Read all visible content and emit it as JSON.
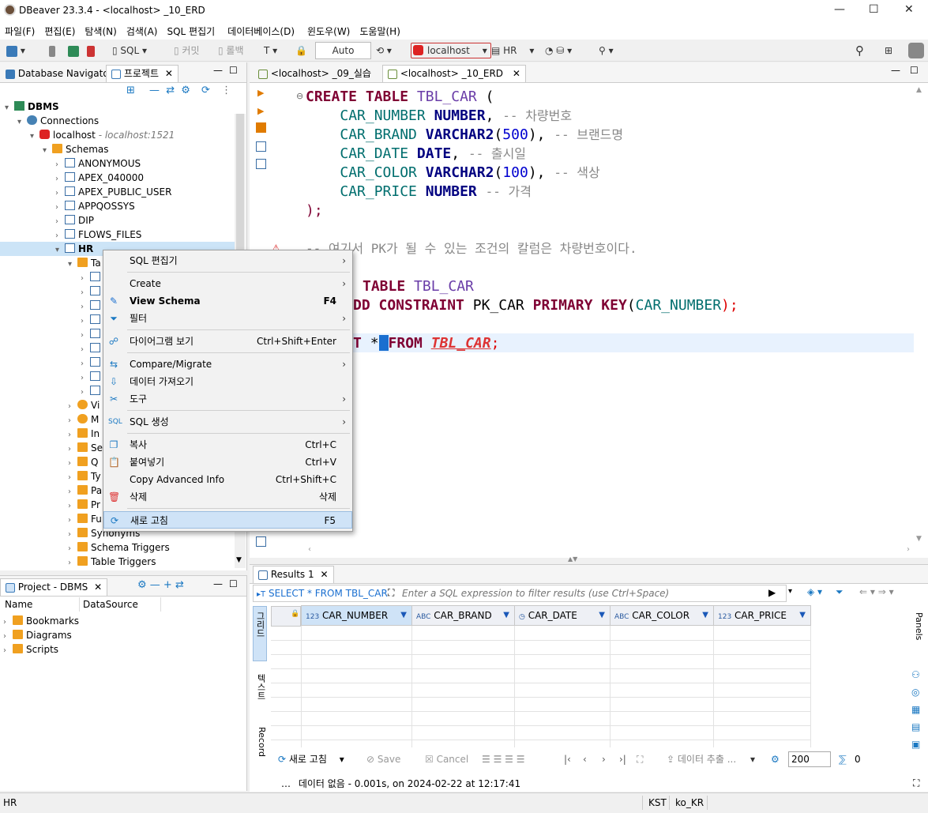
{
  "window": {
    "title": "DBeaver 23.3.4 - <localhost> _10_ERD",
    "minimize": "—",
    "maximize": "☐",
    "close": "✕"
  },
  "menu": [
    "파일(F)",
    "편집(E)",
    "탐색(N)",
    "검색(A)",
    "SQL 편집기",
    "데이터베이스(D)",
    "윈도우(W)",
    "도움말(H)"
  ],
  "toolbar": {
    "sql": "SQL",
    "commit": "커밋",
    "rollback": "롤백",
    "mode": "Auto",
    "connection": "localhost",
    "schema": "HR"
  },
  "left_tabs": {
    "navigator": "Database Navigator",
    "project": "프로젝트",
    "close": "✕"
  },
  "tree": {
    "dbms": "DBMS",
    "connections": "Connections",
    "localhost": "localhost",
    "localhost_host": " - localhost:1521",
    "schemas": "Schemas",
    "schema_list": [
      "ANONYMOUS",
      "APEX_040000",
      "APEX_PUBLIC_USER",
      "APPQOSSYS",
      "DIP",
      "FLOWS_FILES"
    ],
    "hr": "HR",
    "tables": "Ta",
    "partials": [
      "Vi",
      "M",
      "In",
      "Se",
      "Q",
      "Ty",
      "Pa",
      "Pr",
      "Fu"
    ],
    "bottom": [
      "Synonyms",
      "Schema Triggers",
      "Table Triggers"
    ]
  },
  "project": {
    "tab": "Project - DBMS",
    "close": "✕",
    "col_name": "Name",
    "col_ds": "DataSource",
    "items": [
      "Bookmarks",
      "Diagrams",
      "Scripts"
    ]
  },
  "editor_tabs": [
    {
      "label": "<localhost> _09_실습"
    },
    {
      "label": "<localhost> _10_ERD",
      "close": "✕"
    }
  ],
  "code": {
    "l1": {
      "kw": "CREATE TABLE",
      "name": "TBL_CAR",
      "paren": " ("
    },
    "l2": {
      "col": "CAR_NUMBER",
      "type": "NUMBER",
      "rest": ",",
      "cmt": "-- 차량번호"
    },
    "l3": {
      "col": "CAR_BRAND",
      "type": "VARCHAR2",
      "open": "(",
      "n": "500",
      "close": "),",
      "cmt": "-- 브랜드명"
    },
    "l4": {
      "col": "CAR_DATE",
      "type": "DATE",
      "rest": ",",
      "cmt": "-- 출시일"
    },
    "l5": {
      "col": "CAR_COLOR",
      "type": "VARCHAR2",
      "open": "(",
      "n": "100",
      "close": "),",
      "cmt": "-- 색상"
    },
    "l6": {
      "col": "CAR_PRICE",
      "type": "NUMBER",
      "cmt": "-- 가격"
    },
    "l7": ");",
    "l9": "-- 여기서 PK가 될 수 있는 조건의 칼럼은 차량번호이다.",
    "l11": {
      "kw": "TABLE",
      "name": "TBL_CAR"
    },
    "l12": {
      "kw": "DD CONSTRAINT",
      "pk": "PK_CAR",
      "kw2": "PRIMARY KEY",
      "open": "(",
      "col": "CAR_NUMBER",
      "close": ");"
    },
    "l14": {
      "kw": "T",
      "star": "*",
      "from": "FROM",
      "table": "TBL_CAR",
      "semi": ";"
    }
  },
  "context_menu": [
    {
      "label": "SQL 편집기",
      "shortcut": "",
      "sub": "›"
    },
    {
      "label": "Create",
      "shortcut": "",
      "sub": "›"
    },
    {
      "label": "View Schema",
      "shortcut": "F4",
      "sub": ""
    },
    {
      "label": "필터",
      "shortcut": "",
      "sub": "›"
    },
    {
      "label": "다이어그램 보기",
      "shortcut": "Ctrl+Shift+Enter",
      "sub": ""
    },
    {
      "label": "Compare/Migrate",
      "shortcut": "",
      "sub": "›"
    },
    {
      "label": "데이터 가져오기",
      "shortcut": "",
      "sub": ""
    },
    {
      "label": "도구",
      "shortcut": "",
      "sub": "›"
    },
    {
      "label": "SQL 생성",
      "shortcut": "",
      "sub": "›"
    },
    {
      "label": "복사",
      "shortcut": "Ctrl+C",
      "sub": ""
    },
    {
      "label": "붙여넣기",
      "shortcut": "Ctrl+V",
      "sub": ""
    },
    {
      "label": "Copy Advanced Info",
      "shortcut": "Ctrl+Shift+C",
      "sub": ""
    },
    {
      "label": "삭제",
      "shortcut": "삭제",
      "sub": ""
    },
    {
      "label": "새로 고침",
      "shortcut": "F5",
      "sub": ""
    }
  ],
  "results": {
    "tab": "Results 1",
    "close": "✕",
    "query": "SELECT * FROM TBL_CAR",
    "filter_placeholder": "Enter a SQL expression to filter results (use Ctrl+Space)",
    "side_grid": "그리드",
    "side_text": "텍스트",
    "side_record": "Record",
    "panels": "Panels",
    "columns": [
      {
        "type": "123",
        "name": "CAR_NUMBER"
      },
      {
        "type": "ABC",
        "name": "CAR_BRAND"
      },
      {
        "type": "◷",
        "name": "CAR_DATE"
      },
      {
        "type": "ABC",
        "name": "CAR_COLOR"
      },
      {
        "type": "123",
        "name": "CAR_PRICE"
      }
    ],
    "refresh": "새로 고침",
    "save": "Save",
    "cancel": "Cancel",
    "export": "데이터 추출 ...",
    "fetch_size": "200",
    "row_count": "0",
    "status": "데이터 없음 - 0.001s, on 2024-02-22 at 12:17:41"
  },
  "statusbar": {
    "left": "HR",
    "tz": "KST",
    "locale": "ko_KR"
  },
  "colors": {
    "selection": "#cce4f7",
    "menu_highlight": "#cfe3f7",
    "keyword": "#7f0033",
    "comment": "#888888"
  }
}
